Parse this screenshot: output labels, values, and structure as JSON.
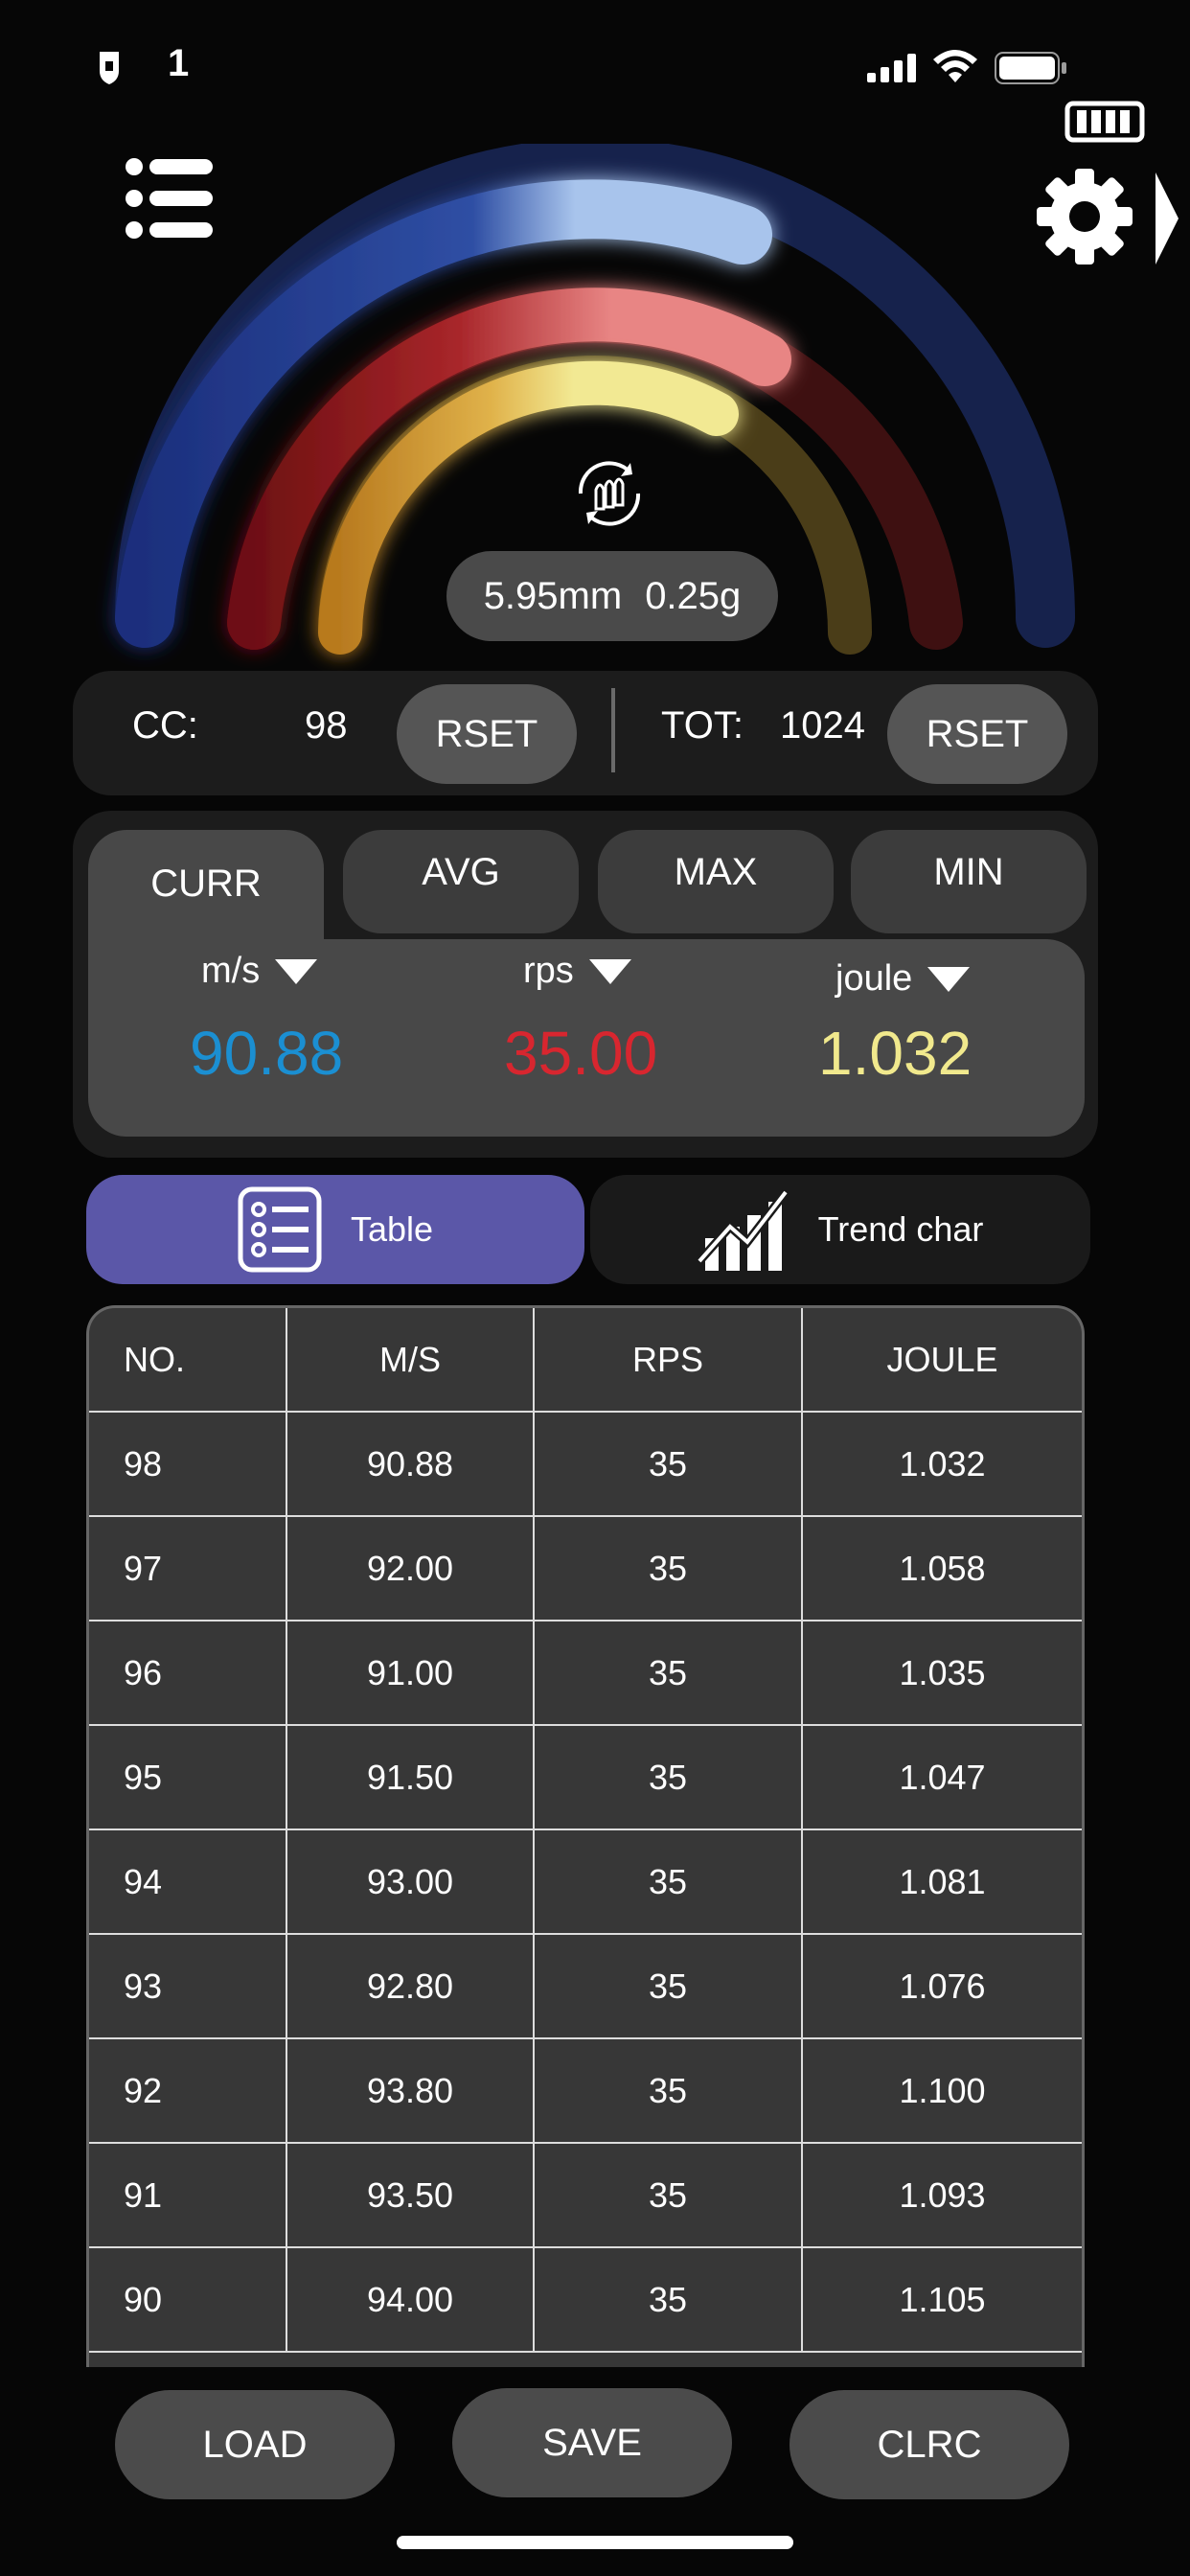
{
  "status_bar": {
    "time": "1"
  },
  "colors": {
    "blue": "#1b8fd2",
    "red": "#d8262f",
    "yellow": "#f1e98d",
    "accent": "#5b57a8"
  },
  "gauge": {
    "spec_diameter": "5.95mm",
    "spec_weight": "0.25g"
  },
  "counters": {
    "cc_label": "CC:",
    "cc_value": "98",
    "tot_label": "TOT:",
    "tot_value": "1024",
    "reset_label": "RSET"
  },
  "stats": {
    "tabs": [
      "CURR",
      "AVG",
      "MAX",
      "MIN"
    ],
    "active_tab": "CURR",
    "units": [
      "m/s",
      "rps",
      "joule"
    ],
    "values": [
      "90.88",
      "35.00",
      "1.032"
    ]
  },
  "view_toggle": {
    "table_label": "Table",
    "trend_label": "Trend char"
  },
  "table": {
    "headers": [
      "NO.",
      "M/S",
      "RPS",
      "JOULE"
    ],
    "rows": [
      [
        "98",
        "90.88",
        "35",
        "1.032"
      ],
      [
        "97",
        "92.00",
        "35",
        "1.058"
      ],
      [
        "96",
        "91.00",
        "35",
        "1.035"
      ],
      [
        "95",
        "91.50",
        "35",
        "1.047"
      ],
      [
        "94",
        "93.00",
        "35",
        "1.081"
      ],
      [
        "93",
        "92.80",
        "35",
        "1.076"
      ],
      [
        "92",
        "93.80",
        "35",
        "1.100"
      ],
      [
        "91",
        "93.50",
        "35",
        "1.093"
      ],
      [
        "90",
        "94.00",
        "35",
        "1.105"
      ]
    ]
  },
  "actions": {
    "load": "LOAD",
    "save": "SAVE",
    "clear": "CLRC"
  },
  "icons": [
    "menu-icon",
    "settings-icon",
    "battery-icon",
    "cellular-signal-icon",
    "wifi-icon",
    "reload-ammo-icon",
    "list-icon",
    "trend-chart-icon"
  ]
}
